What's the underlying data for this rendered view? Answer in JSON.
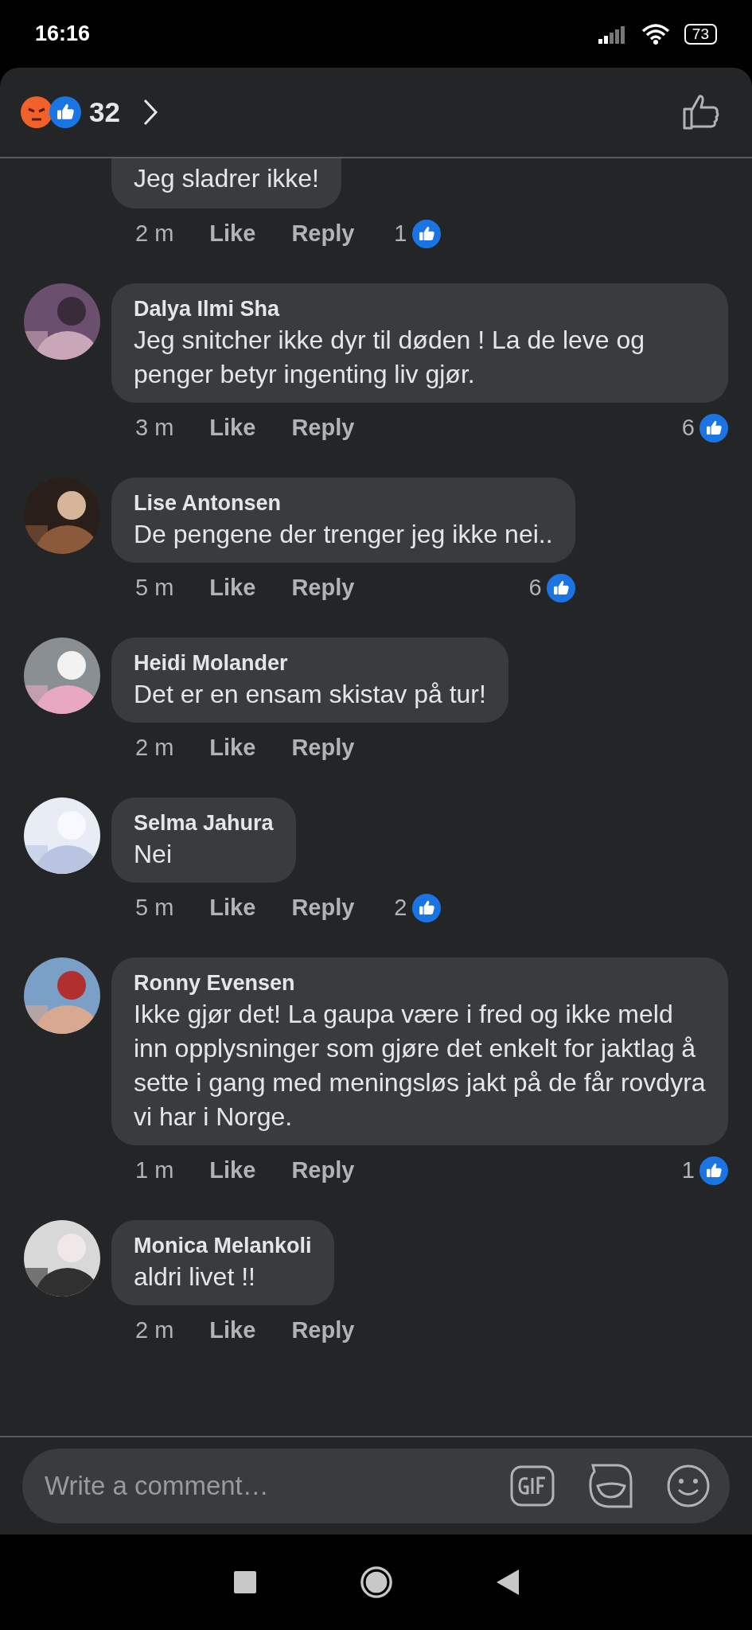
{
  "status_bar": {
    "time": "16:16",
    "battery": "73"
  },
  "header": {
    "reaction_count": "32"
  },
  "comments": [
    {
      "text": "Jeg sladrer ikke!",
      "time": "2 m",
      "like": "Like",
      "reply": "Reply",
      "reactions": "1"
    },
    {
      "name": "Dalya Ilmi Sha",
      "text": "Jeg snitcher ikke dyr til døden ! La de leve og penger betyr ingenting liv gjør.",
      "time": "3 m",
      "like": "Like",
      "reply": "Reply",
      "reactions": "6"
    },
    {
      "name": "Lise Antonsen",
      "text": "De pengene der trenger jeg ikke nei..",
      "time": "5 m",
      "like": "Like",
      "reply": "Reply",
      "reactions": "6"
    },
    {
      "name": "Heidi Molander",
      "text": "Det er en ensam skistav på tur!",
      "time": "2 m",
      "like": "Like",
      "reply": "Reply"
    },
    {
      "name": "Selma Jahura",
      "text": "Nei",
      "time": "5 m",
      "like": "Like",
      "reply": "Reply",
      "reactions": "2"
    },
    {
      "name": "Ronny Evensen",
      "text": "Ikke gjør det! La gaupa være i fred og ikke meld inn opplysninger som gjøre det enkelt for jaktlag å sette i gang med meningsløs jakt på de får rovdyra vi har i Norge.",
      "time": "1 m",
      "like": "Like",
      "reply": "Reply",
      "reactions": "1"
    },
    {
      "name": "Monica Melankoli",
      "text": "aldri livet !!",
      "time": "2 m",
      "like": "Like",
      "reply": "Reply"
    }
  ],
  "composer": {
    "placeholder": "Write a comment…"
  }
}
